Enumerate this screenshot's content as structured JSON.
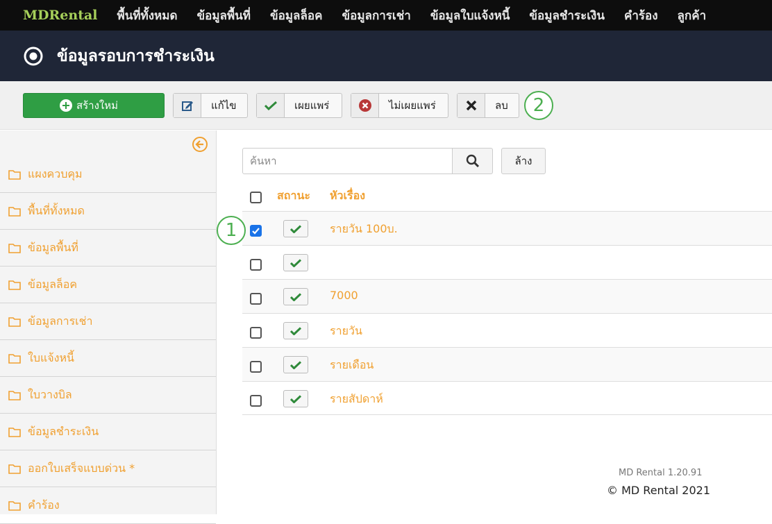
{
  "topnav": {
    "brand": "MDRental",
    "items": [
      "พื้นที่ทั้งหมด",
      "ข้อมูลพื้นที่",
      "ข้อมูลล็อค",
      "ข้อมูลการเช่า",
      "ข้อมูลใบแจ้งหนี้",
      "ข้อมูลชำระเงิน",
      "คำร้อง",
      "ลูกค้า"
    ]
  },
  "header": {
    "title": "ข้อมูลรอบการชำระเงิน",
    "icon": "radio-circle-icon"
  },
  "toolbar": {
    "new_label": "สร้างใหม่",
    "edit_label": "แก้ไข",
    "publish_label": "เผยแพร่",
    "unpublish_label": "ไม่เผยแพร่",
    "delete_label": "ลบ",
    "annotation": "2"
  },
  "sidebar": {
    "items": [
      {
        "label": "แผงควบคุม"
      },
      {
        "label": "พื้นที่ทั้งหมด"
      },
      {
        "label": "ข้อมูลพื้นที่"
      },
      {
        "label": "ข้อมูลล็อค"
      },
      {
        "label": "ข้อมูลการเช่า"
      },
      {
        "label": "ใบแจ้งหนี้"
      },
      {
        "label": "ใบวางบิล"
      },
      {
        "label": "ข้อมูลชำระเงิน"
      },
      {
        "label": "ออกใบเสร็จแบบด่วน *"
      },
      {
        "label": "คำร้อง"
      }
    ]
  },
  "search": {
    "placeholder": "ค้นหา",
    "value": "",
    "clear_label": "ล้าง"
  },
  "table": {
    "headers": {
      "status": "สถานะ",
      "title": "หัวเรื่อง"
    },
    "rows": [
      {
        "title": "รายวัน 100บ.",
        "checked": true,
        "published": true
      },
      {
        "title": "",
        "checked": false,
        "published": true
      },
      {
        "title": "7000",
        "checked": false,
        "published": true
      },
      {
        "title": "รายวัน",
        "checked": false,
        "published": true
      },
      {
        "title": "รายเดือน",
        "checked": false,
        "published": true
      },
      {
        "title": "รายสัปดาห์",
        "checked": false,
        "published": true
      }
    ],
    "annotation": "1"
  },
  "footer": {
    "version": "MD Rental 1.20.91",
    "copyright": "© MD Rental 2021"
  },
  "colors": {
    "accent": "#f0a030",
    "success": "#2f9e44",
    "nav_bg": "#0d0d0d",
    "title_bg": "#1f2637",
    "brand": "#a6cf5a"
  }
}
